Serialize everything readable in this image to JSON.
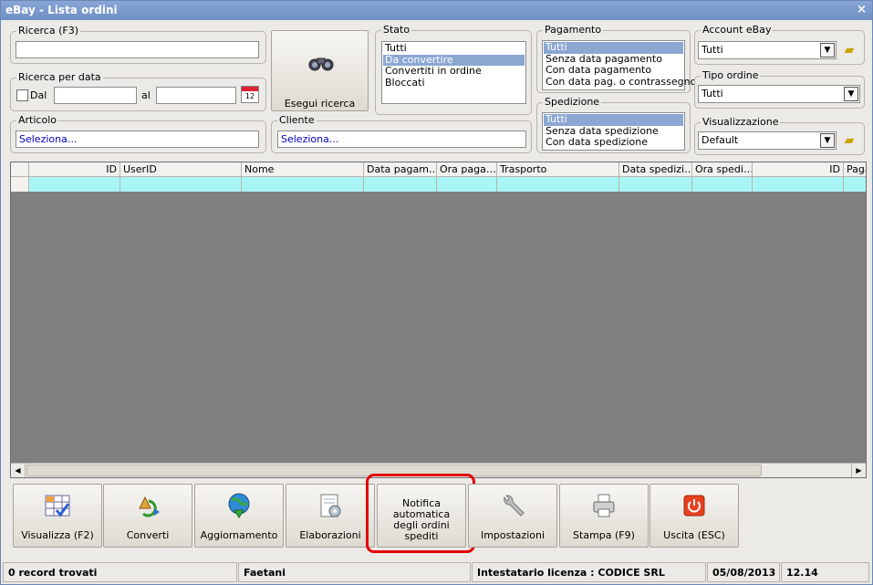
{
  "window": {
    "title": "eBay - Lista ordini",
    "close_glyph": "×"
  },
  "ricerca": {
    "label": "Ricerca (F3)",
    "value": ""
  },
  "ricerca_data": {
    "label": "Ricerca per data",
    "dal_label": "Dal",
    "al_label": "al",
    "dal_value": "",
    "al_value": "",
    "calendar_day": "12"
  },
  "articolo": {
    "label": "Articolo",
    "value": "Seleziona..."
  },
  "cliente": {
    "label": "Cliente",
    "value": "Seleziona..."
  },
  "search_button": {
    "label": "Esegui ricerca",
    "icon": "binoculars-icon"
  },
  "stato": {
    "label": "Stato",
    "options": [
      "Tutti",
      "Da convertire",
      "Convertiti in ordine",
      "Bloccati"
    ],
    "selected": "Da convertire"
  },
  "pagamento": {
    "label": "Pagamento",
    "options": [
      "Tutti",
      "Senza data pagamento",
      "Con data pagamento",
      "Con data pag. o contrassegno"
    ],
    "selected": "Tutti"
  },
  "spedizione": {
    "label": "Spedizione",
    "options": [
      "Tutti",
      "Senza data spedizione",
      "Con data spedizione"
    ],
    "selected": "Tutti"
  },
  "account_ebay": {
    "label": "Account eBay",
    "value": "Tutti"
  },
  "tipo_ordine": {
    "label": "Tipo ordine",
    "value": "Tutti"
  },
  "visualizzazione": {
    "label": "Visualizzazione",
    "value": "Default"
  },
  "grid": {
    "columns": [
      "ID",
      "UserID",
      "Nome",
      "Data pagam…",
      "Ora paga…",
      "Trasporto",
      "Data spedizi…",
      "Ora spedi…",
      "ID",
      "Paga"
    ],
    "row_color": "#a9f5f5",
    "background_color": "#808080"
  },
  "toolbar": [
    {
      "label": "Visualizza (F2)",
      "icon": "grid-check-icon"
    },
    {
      "label": "Converti",
      "icon": "convert-arrows-icon"
    },
    {
      "label": "Aggiornamento",
      "icon": "globe-download-icon"
    },
    {
      "label": "Elaborazioni",
      "icon": "document-gear-icon"
    },
    {
      "label": "Notifica automatica degli ordini spediti",
      "icon": ""
    },
    {
      "label": "Impostazioni",
      "icon": "wrench-icon"
    },
    {
      "label": "Stampa (F9)",
      "icon": "printer-icon"
    },
    {
      "label": "Uscita (ESC)",
      "icon": "power-icon"
    }
  ],
  "highlight_color": "#e30000",
  "status": {
    "records": "0 record trovati",
    "user": "Faetani",
    "license": "Intestatario licenza : CODICE SRL",
    "date": "05/08/2013",
    "time": "12.14"
  }
}
